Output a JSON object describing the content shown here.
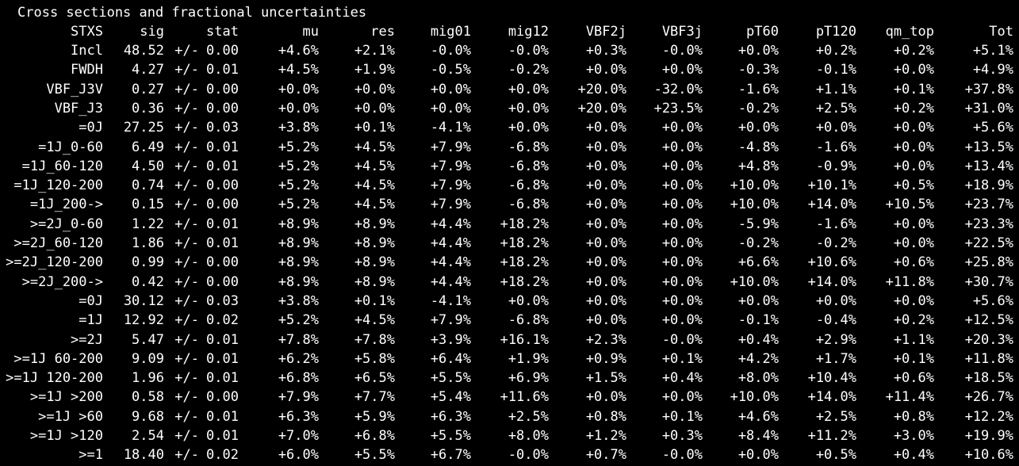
{
  "title": "Cross sections and fractional uncertainties",
  "columns": [
    "STXS",
    "sig",
    "",
    "stat",
    "mu",
    "res",
    "mig01",
    "mig12",
    "VBF2j",
    "VBF3j",
    "pT60",
    "pT120",
    "qm_top",
    "Tot"
  ],
  "rows": [
    [
      "Incl",
      "48.52",
      "+/-",
      "0.00",
      "+4.6%",
      "+2.1%",
      "-0.0%",
      "-0.0%",
      "+0.3%",
      "-0.0%",
      "+0.0%",
      "+0.2%",
      "+0.2%",
      "+5.1%"
    ],
    [
      "FWDH",
      "4.27",
      "+/-",
      "0.01",
      "+4.5%",
      "+1.9%",
      "-0.5%",
      "-0.2%",
      "+0.0%",
      "+0.0%",
      "-0.3%",
      "-0.1%",
      "+0.0%",
      "+4.9%"
    ],
    [
      "VBF_J3V",
      "0.27",
      "+/-",
      "0.00",
      "+0.0%",
      "+0.0%",
      "+0.0%",
      "+0.0%",
      "+20.0%",
      "-32.0%",
      "-1.6%",
      "+1.1%",
      "+0.1%",
      "+37.8%"
    ],
    [
      "VBF_J3",
      "0.36",
      "+/-",
      "0.00",
      "+0.0%",
      "+0.0%",
      "+0.0%",
      "+0.0%",
      "+20.0%",
      "+23.5%",
      "-0.2%",
      "+2.5%",
      "+0.2%",
      "+31.0%"
    ],
    [
      "=0J",
      "27.25",
      "+/-",
      "0.03",
      "+3.8%",
      "+0.1%",
      "-4.1%",
      "+0.0%",
      "+0.0%",
      "+0.0%",
      "+0.0%",
      "+0.0%",
      "+0.0%",
      "+5.6%"
    ],
    [
      "=1J_0-60",
      "6.49",
      "+/-",
      "0.01",
      "+5.2%",
      "+4.5%",
      "+7.9%",
      "-6.8%",
      "+0.0%",
      "+0.0%",
      "-4.8%",
      "-1.6%",
      "+0.0%",
      "+13.5%"
    ],
    [
      "=1J_60-120",
      "4.50",
      "+/-",
      "0.01",
      "+5.2%",
      "+4.5%",
      "+7.9%",
      "-6.8%",
      "+0.0%",
      "+0.0%",
      "+4.8%",
      "-0.9%",
      "+0.0%",
      "+13.4%"
    ],
    [
      "=1J_120-200",
      "0.74",
      "+/-",
      "0.00",
      "+5.2%",
      "+4.5%",
      "+7.9%",
      "-6.8%",
      "+0.0%",
      "+0.0%",
      "+10.0%",
      "+10.1%",
      "+0.5%",
      "+18.9%"
    ],
    [
      "=1J_200->",
      "0.15",
      "+/-",
      "0.00",
      "+5.2%",
      "+4.5%",
      "+7.9%",
      "-6.8%",
      "+0.0%",
      "+0.0%",
      "+10.0%",
      "+14.0%",
      "+10.5%",
      "+23.7%"
    ],
    [
      ">=2J_0-60",
      "1.22",
      "+/-",
      "0.01",
      "+8.9%",
      "+8.9%",
      "+4.4%",
      "+18.2%",
      "+0.0%",
      "+0.0%",
      "-5.9%",
      "-1.6%",
      "+0.0%",
      "+23.3%"
    ],
    [
      ">=2J_60-120",
      "1.86",
      "+/-",
      "0.01",
      "+8.9%",
      "+8.9%",
      "+4.4%",
      "+18.2%",
      "+0.0%",
      "+0.0%",
      "-0.2%",
      "-0.2%",
      "+0.0%",
      "+22.5%"
    ],
    [
      ">=2J_120-200",
      "0.99",
      "+/-",
      "0.00",
      "+8.9%",
      "+8.9%",
      "+4.4%",
      "+18.2%",
      "+0.0%",
      "+0.0%",
      "+6.6%",
      "+10.6%",
      "+0.6%",
      "+25.8%"
    ],
    [
      ">=2J_200->",
      "0.42",
      "+/-",
      "0.00",
      "+8.9%",
      "+8.9%",
      "+4.4%",
      "+18.2%",
      "+0.0%",
      "+0.0%",
      "+10.0%",
      "+14.0%",
      "+11.8%",
      "+30.7%"
    ],
    [
      "=0J",
      "30.12",
      "+/-",
      "0.03",
      "+3.8%",
      "+0.1%",
      "-4.1%",
      "+0.0%",
      "+0.0%",
      "+0.0%",
      "+0.0%",
      "+0.0%",
      "+0.0%",
      "+5.6%"
    ],
    [
      "=1J",
      "12.92",
      "+/-",
      "0.02",
      "+5.2%",
      "+4.5%",
      "+7.9%",
      "-6.8%",
      "+0.0%",
      "+0.0%",
      "-0.1%",
      "-0.4%",
      "+0.2%",
      "+12.5%"
    ],
    [
      ">=2J",
      "5.47",
      "+/-",
      "0.01",
      "+7.8%",
      "+7.8%",
      "+3.9%",
      "+16.1%",
      "+2.3%",
      "-0.0%",
      "+0.4%",
      "+2.9%",
      "+1.1%",
      "+20.3%"
    ],
    [
      ">=1J 60-200",
      "9.09",
      "+/-",
      "0.01",
      "+6.2%",
      "+5.8%",
      "+6.4%",
      "+1.9%",
      "+0.9%",
      "+0.1%",
      "+4.2%",
      "+1.7%",
      "+0.1%",
      "+11.8%"
    ],
    [
      ">=1J 120-200",
      "1.96",
      "+/-",
      "0.01",
      "+6.8%",
      "+6.5%",
      "+5.5%",
      "+6.9%",
      "+1.5%",
      "+0.4%",
      "+8.0%",
      "+10.4%",
      "+0.6%",
      "+18.5%"
    ],
    [
      ">=1J >200",
      "0.58",
      "+/-",
      "0.00",
      "+7.9%",
      "+7.7%",
      "+5.4%",
      "+11.6%",
      "+0.0%",
      "+0.0%",
      "+10.0%",
      "+14.0%",
      "+11.4%",
      "+26.7%"
    ],
    [
      ">=1J >60",
      "9.68",
      "+/-",
      "0.01",
      "+6.3%",
      "+5.9%",
      "+6.3%",
      "+2.5%",
      "+0.8%",
      "+0.1%",
      "+4.6%",
      "+2.5%",
      "+0.8%",
      "+12.2%"
    ],
    [
      ">=1J >120",
      "2.54",
      "+/-",
      "0.01",
      "+7.0%",
      "+6.8%",
      "+5.5%",
      "+8.0%",
      "+1.2%",
      "+0.3%",
      "+8.4%",
      "+11.2%",
      "+3.0%",
      "+19.9%"
    ],
    [
      ">=1",
      "18.40",
      "+/-",
      "0.02",
      "+6.0%",
      "+5.5%",
      "+6.7%",
      "-0.0%",
      "+0.7%",
      "-0.0%",
      "+0.0%",
      "+0.5%",
      "+0.4%",
      "+10.6%"
    ]
  ],
  "colors": {
    "background": "#000000",
    "text": "#ffffff"
  }
}
